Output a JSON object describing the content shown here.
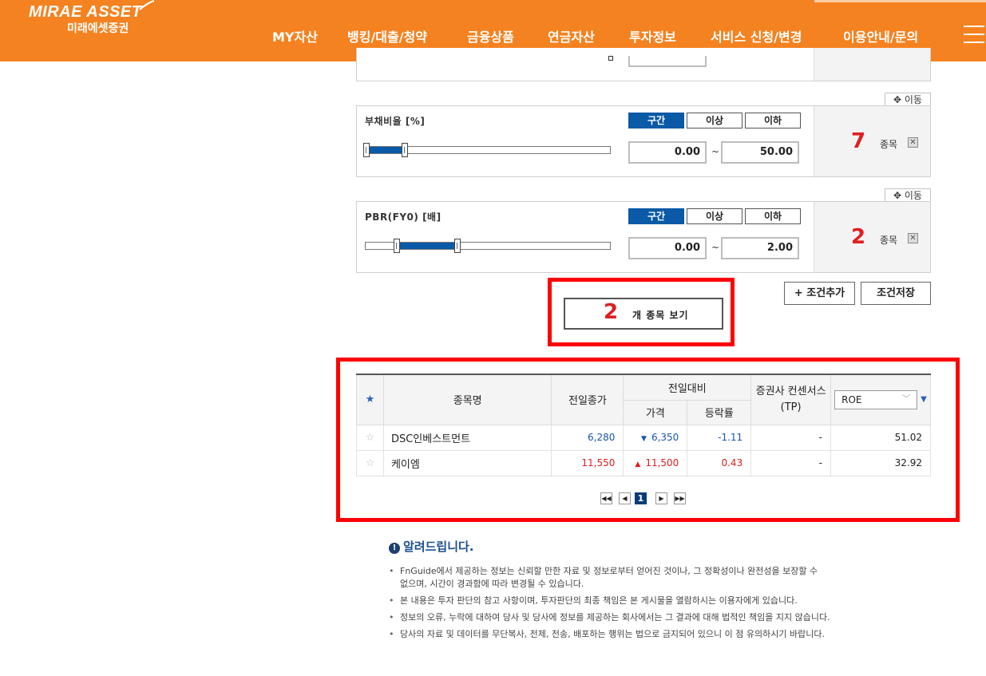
{
  "header": {
    "logo_text": "MIRAE ASSET",
    "logo_sub": "미래에셋증권",
    "nav": [
      "MY자산",
      "뱅킹/대출/청약",
      "금융상품",
      "연금자산",
      "투자정보",
      "서비스 신청/변경",
      "이용안내/문의"
    ],
    "active_nav": "투자정보",
    "brand_color": "#f58220"
  },
  "conditions": [
    {
      "label": "부채비율 [%]",
      "segments": [
        "구간",
        "이상",
        "이하"
      ],
      "active_segment": "구간",
      "min_value": "0.00",
      "max_value": "50.00",
      "range_fraction": [
        0.0,
        0.16
      ],
      "count": "7",
      "count_unit": "종목",
      "move_label": "이동"
    },
    {
      "label": "PBR(FY0) [배]",
      "segments": [
        "구간",
        "이상",
        "이하"
      ],
      "active_segment": "구간",
      "min_value": "0.00",
      "max_value": "2.00",
      "range_fraction": [
        0.13,
        0.38
      ],
      "count": "2",
      "count_unit": "종목",
      "move_label": "이동"
    }
  ],
  "actions": {
    "view_count": "2",
    "view_label": "개 종목 보기",
    "add_condition": "+ 조건추가",
    "save_condition": "조건저장"
  },
  "table": {
    "headers": {
      "name": "종목명",
      "prev_close": "전일종가",
      "change_group": "전일대비",
      "price": "가격",
      "rate": "등락률",
      "consensus": "증권사 컨센서스(TP)",
      "roe_select": "ROE"
    },
    "rows": [
      {
        "name": "DSC인베스트먼트",
        "prev_close": "6,280",
        "direction": "down",
        "price": "6,350",
        "rate": "-1.11",
        "consensus": "-",
        "roe": "51.02"
      },
      {
        "name": "케이엠",
        "prev_close": "11,550",
        "direction": "up",
        "price": "11,500",
        "rate": "0.43",
        "consensus": "-",
        "roe": "32.92"
      }
    ],
    "pager": {
      "current": "1"
    }
  },
  "notice": {
    "title": "알려드립니다.",
    "items": [
      "FnGuide에서 제공하는 정보는 신뢰할 만한 자료 및 정보로부터 얻어진 것이나, 그 정확성이나 완전성을 보장할 수 없으며, 시간이 경과함에 따라 변경될 수 있습니다.",
      "본 내용은 투자 판단의 참고 사항이며, 투자판단의 최종 책임은 본 게시물을 열람하시는 이용자에게 있습니다.",
      "정보의 오류, 누락에 대하여 당사 및 당사에 정보를 제공하는 회사에서는 그 결과에 대해 법적인 책임을 지지 않습니다.",
      "당사의 자료 및 데이터를 무단복사, 전제, 전송, 배포하는 행위는 법으로 금지되어 있으니 이 점 유의하시기 바랍니다."
    ]
  }
}
